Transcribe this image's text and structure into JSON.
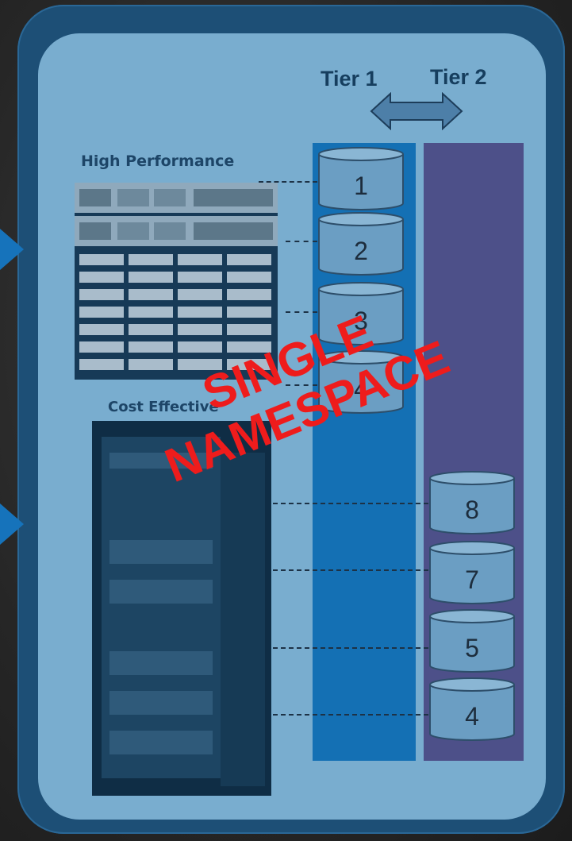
{
  "labels": {
    "high_performance": "High Performance",
    "cost_effective": "Cost Effective",
    "tier1": "Tier 1",
    "tier2": "Tier 2"
  },
  "tier1_disks": [
    "1",
    "2",
    "3",
    "4"
  ],
  "tier2_disks": [
    "8",
    "7",
    "5",
    "4"
  ],
  "watermark": {
    "line1": "SINGLE",
    "line2": "NAMESPACE"
  },
  "colors": {
    "outer_frame": "#1d4f76",
    "inner_panel": "#79adcf",
    "tier1_column": "#1470b4",
    "tier2_column": "#4d5089",
    "watermark": "#ee1c1c"
  }
}
